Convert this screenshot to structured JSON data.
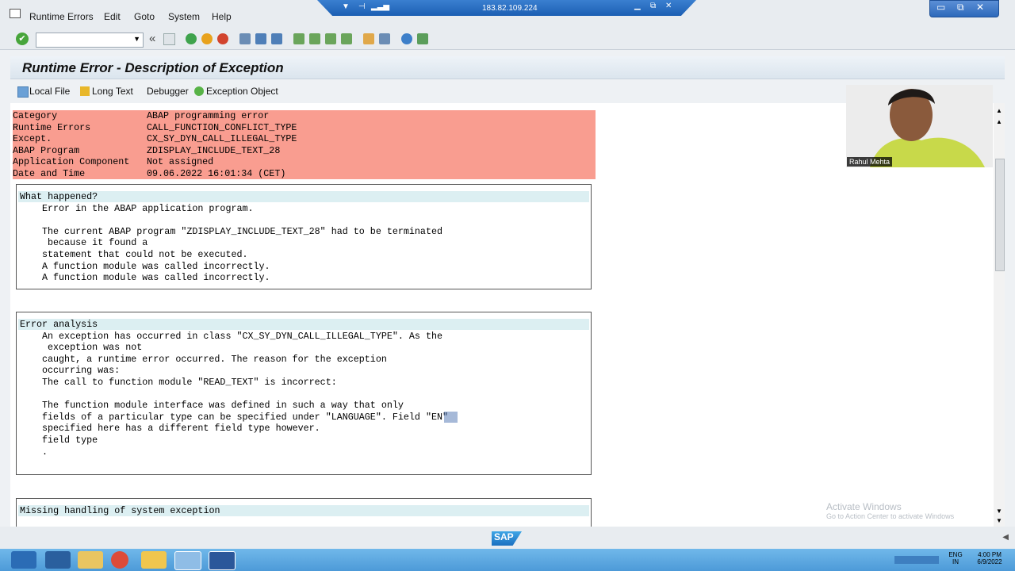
{
  "menu": {
    "items": [
      "Runtime Errors",
      "Edit",
      "Goto",
      "System",
      "Help"
    ],
    "underline": [
      "R",
      "E",
      "G",
      "S",
      "H"
    ]
  },
  "remote": {
    "ip": "183.82.109.224"
  },
  "toolbar": {
    "back_symbol": "«"
  },
  "page": {
    "title": "Runtime Error - Description of Exception"
  },
  "app_toolbar": {
    "local_file": "Local File",
    "long_text": "Long Text",
    "debugger": "Debugger",
    "exception_object": "Exception Object"
  },
  "info": [
    {
      "label": "Category",
      "value": "ABAP programming error"
    },
    {
      "label": "Runtime Errors",
      "value": "CALL_FUNCTION_CONFLICT_TYPE"
    },
    {
      "label": "Except.",
      "value": "CX_SY_DYN_CALL_ILLEGAL_TYPE"
    },
    {
      "label": "ABAP Program",
      "value": "ZDISPLAY_INCLUDE_TEXT_28"
    },
    {
      "label": "Application Component",
      "value": "Not assigned"
    },
    {
      "label": "Date and Time",
      "value": "09.06.2022 16:01:34 (CET)"
    }
  ],
  "what_happened": {
    "heading": "What happened?",
    "lines": [
      "Error in the ABAP application program.",
      "",
      "The current ABAP program \"ZDISPLAY_INCLUDE_TEXT_28\" had to be terminated",
      " because it found a",
      "statement that could not be executed.",
      "A function module was called incorrectly.",
      "A function module was called incorrectly."
    ]
  },
  "error_analysis": {
    "heading": "Error analysis",
    "lines": [
      "An exception has occurred in class \"CX_SY_DYN_CALL_ILLEGAL_TYPE\". As the",
      " exception was not",
      "caught, a runtime error occurred. The reason for the exception",
      "occurring was:",
      "The call to function module \"READ_TEXT\" is incorrect:",
      "",
      "The function module interface was defined in such a way that only",
      "fields of a particular type can be specified under \"LANGUAGE\". Field \"EN\"",
      "specified here has a different field type however.",
      "field type",
      "."
    ]
  },
  "missing_handling": {
    "heading": "Missing handling of system exception"
  },
  "webcam": {
    "name": "Rahul Mehta"
  },
  "watermark": {
    "title": "Activate Windows",
    "subtitle": "Go to Action Center to activate Windows"
  },
  "tray": {
    "lang": "ENG",
    "region": "IN",
    "time": "4:00 PM",
    "date": "6/9/2022"
  },
  "colors": {
    "info_bg": "#f99d90",
    "section_head_bg": "#dceff2",
    "taskbar": "#4d9ad8"
  }
}
